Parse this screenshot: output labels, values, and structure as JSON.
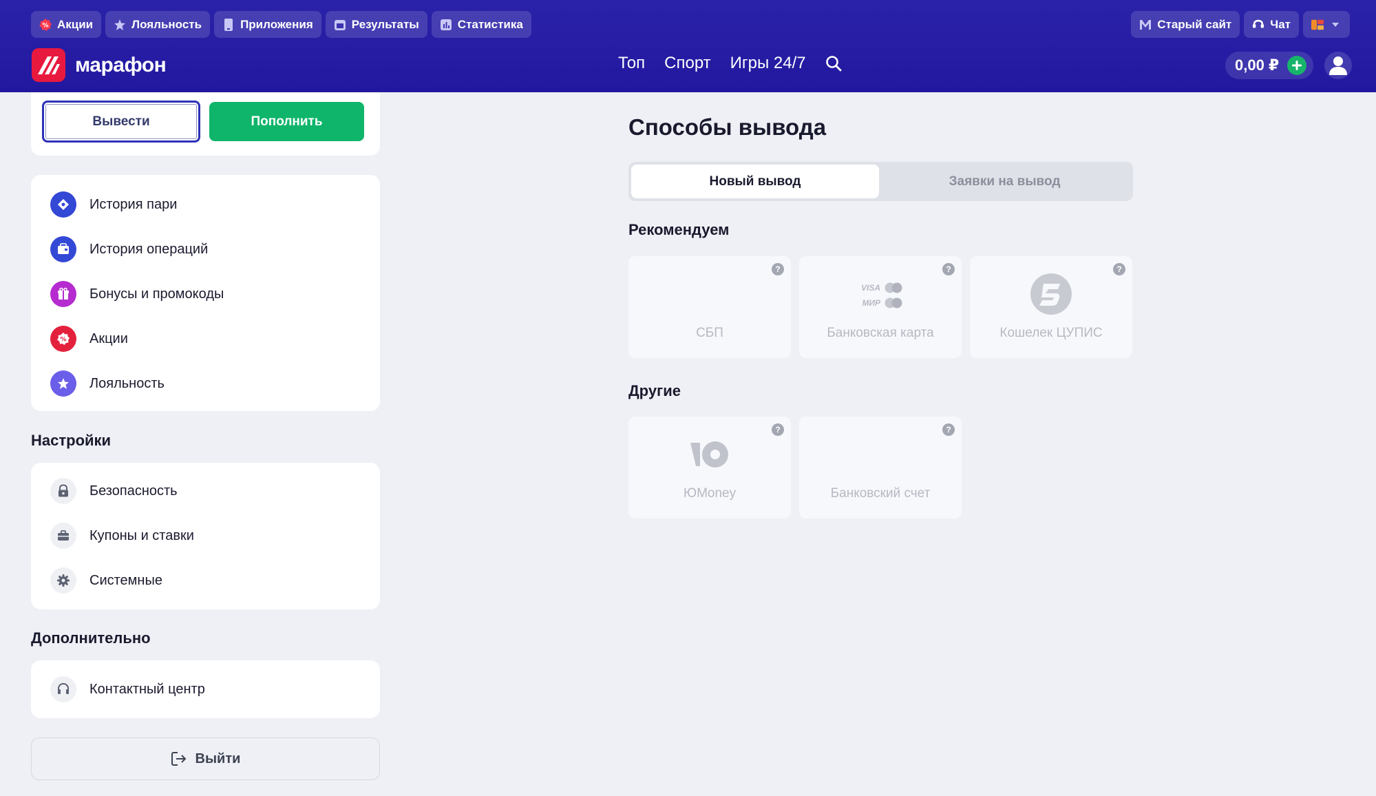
{
  "header": {
    "top_links": [
      {
        "label": "Акции",
        "icon": "badge-percent-icon"
      },
      {
        "label": "Лояльность",
        "icon": "star-badge-icon"
      },
      {
        "label": "Приложения",
        "icon": "phone-icon"
      },
      {
        "label": "Результаты",
        "icon": "calendar-icon"
      },
      {
        "label": "Статистика",
        "icon": "chart-icon"
      }
    ],
    "old_site": "Старый сайт",
    "chat": "Чат",
    "brand": "марафон",
    "nav": [
      "Топ",
      "Спорт",
      "Игры 24/7"
    ],
    "balance": "0,00 ₽"
  },
  "sidebar": {
    "withdraw_label": "Вывести",
    "deposit_label": "Пополнить",
    "menu": [
      {
        "label": "История пари",
        "color": "#3448d6"
      },
      {
        "label": "История операций",
        "color": "#3448d6"
      },
      {
        "label": "Бонусы и промокоды",
        "color": "#b52bd0"
      },
      {
        "label": "Акции",
        "color": "#e4213d"
      },
      {
        "label": "Лояльность",
        "color": "#6b5ee8"
      }
    ],
    "settings_title": "Настройки",
    "settings": [
      {
        "label": "Безопасность",
        "icon": "lock-icon"
      },
      {
        "label": "Купоны и ставки",
        "icon": "briefcase-icon"
      },
      {
        "label": "Системные",
        "icon": "gear-icon"
      }
    ],
    "extra_title": "Дополнительно",
    "extra": [
      {
        "label": "Контактный центр",
        "icon": "headset-icon"
      }
    ],
    "logout_label": "Выйти"
  },
  "main": {
    "title": "Способы вывода",
    "tabs": [
      "Новый вывод",
      "Заявки на вывод"
    ],
    "recommended_title": "Рекомендуем",
    "recommended": [
      {
        "label": "СБП"
      },
      {
        "label": "Банковская карта",
        "card_brands": [
          "VISA",
          "МИР"
        ]
      },
      {
        "label": "Кошелек ЦУПИС"
      }
    ],
    "other_title": "Другие",
    "other": [
      {
        "label": "ЮMoney"
      },
      {
        "label": "Банковский счет"
      }
    ]
  }
}
